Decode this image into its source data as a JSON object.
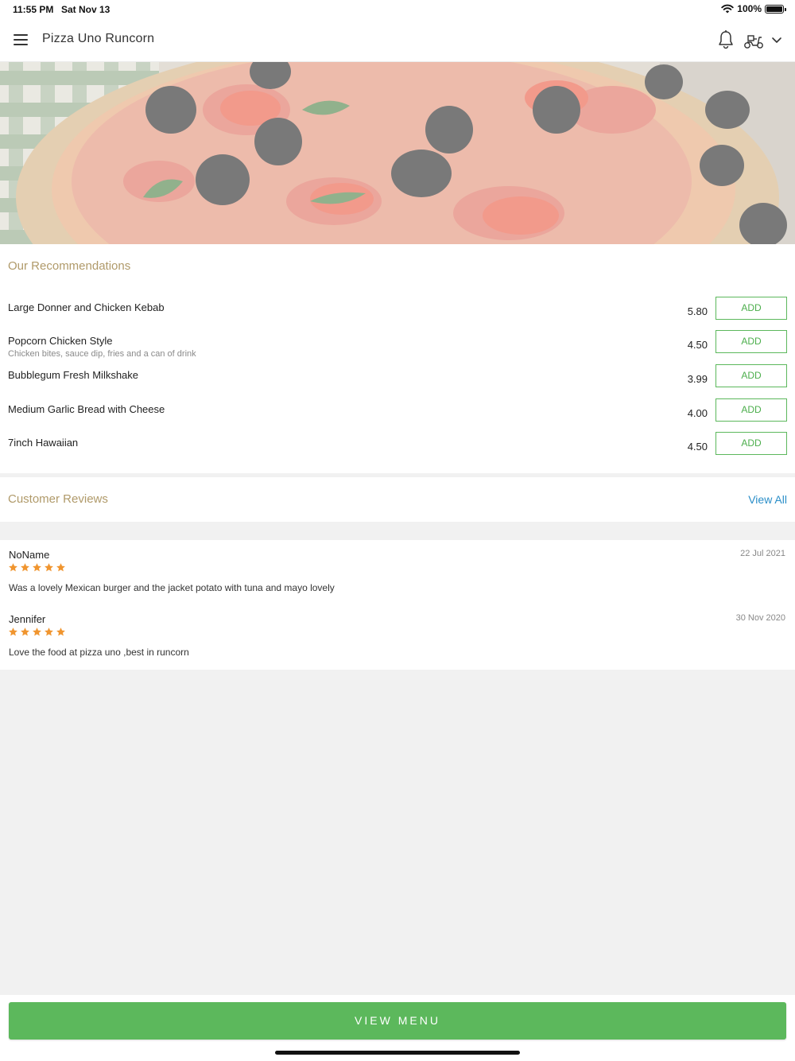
{
  "status_bar": {
    "time": "11:55 PM",
    "date": "Sat Nov 13",
    "battery": "100%"
  },
  "header": {
    "title": "Pizza Uno Runcorn",
    "icons": [
      "menu-icon",
      "bell-icon",
      "scooter-icon",
      "chevron-down-icon"
    ]
  },
  "recommendations": {
    "title": "Our Recommendations",
    "add_label": "ADD",
    "items": [
      {
        "name": "Large Donner and Chicken Kebab",
        "description": "",
        "price": "5.80"
      },
      {
        "name": "Popcorn Chicken Style",
        "description": "Chicken bites, sauce dip, fries and a can of drink",
        "price": "4.50"
      },
      {
        "name": "Bubblegum Fresh Milkshake",
        "description": "",
        "price": "3.99"
      },
      {
        "name": "Medium Garlic Bread with Cheese",
        "description": "",
        "price": "4.00"
      },
      {
        "name": "7inch Hawaiian",
        "description": "",
        "price": "4.50"
      }
    ]
  },
  "reviews": {
    "title": "Customer Reviews",
    "view_all": "View All",
    "items": [
      {
        "name": "NoName",
        "date": "22 Jul 2021",
        "rating": 5,
        "text": "Was a lovely Mexican burger and the jacket potato with tuna and mayo lovely"
      },
      {
        "name": "Jennifer",
        "date": "30 Nov 2020",
        "rating": 5,
        "text": "Love the food at pizza uno ,best in runcorn"
      }
    ]
  },
  "footer": {
    "cta_label": "VIEW MENU"
  },
  "colors": {
    "accent_green": "#5cb85c",
    "section_title": "#b09a6a",
    "link_blue": "#2a8ec8",
    "star_orange": "#f0952f"
  }
}
